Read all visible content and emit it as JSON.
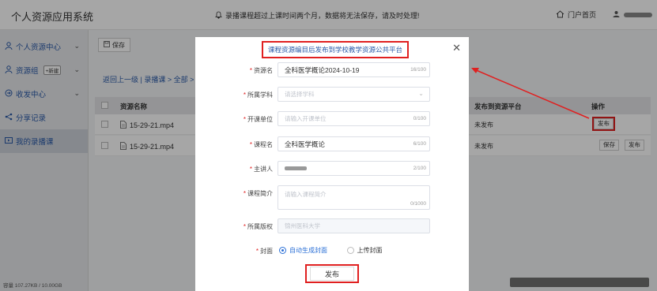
{
  "header": {
    "app_title": "个人资源应用系统",
    "notice": "录播课程超过上课时间两个月，数据将无法保存，请及时处理!",
    "portal_label": "门户首页"
  },
  "sidebar": {
    "items": [
      {
        "label": "个人资源中心",
        "icon": "person-icon",
        "has_chevron": true
      },
      {
        "label": "资源组",
        "icon": "group-icon",
        "badge": "+新建",
        "has_chevron": true
      },
      {
        "label": "收发中心",
        "icon": "transfer-icon",
        "has_chevron": true
      },
      {
        "label": "分享记录",
        "icon": "share-icon"
      },
      {
        "label": "我的录播课",
        "icon": "video-icon",
        "active": true
      }
    ],
    "storage": "容量 107.27KB / 10.00GB"
  },
  "main": {
    "save_label": "保存",
    "breadcrumb": "返回上一级 | 录播课 > 全部 >",
    "columns": {
      "name": "资源名称",
      "platform": "发布到资源平台",
      "ops": "操作"
    },
    "rows": [
      {
        "name": "15-29-21.mp4",
        "status": "未发布",
        "ops": [
          "发布"
        ]
      },
      {
        "name": "15-29-21.mp4",
        "status": "未发布",
        "ops": [
          "保存",
          "发布"
        ]
      }
    ]
  },
  "modal": {
    "title": "课程资源编目后发布到学校教学资源公共平台",
    "fields": {
      "resource_name": {
        "label": "资源名",
        "value": "全科医学概论2024-10-19",
        "count": "16/100"
      },
      "subject": {
        "label": "所属学科",
        "placeholder": "请选择学科"
      },
      "unit": {
        "label": "开课单位",
        "placeholder": "请输入开课单位",
        "count": "0/100"
      },
      "course_name": {
        "label": "课程名",
        "value": "全科医学概论",
        "count": "6/100"
      },
      "lecturer": {
        "label": "主讲人",
        "count": "2/100"
      },
      "intro": {
        "label": "课程简介",
        "placeholder": "请输入课程简介",
        "count": "0/1000"
      },
      "copyright": {
        "label": "所属版权",
        "value": "锦州医科大学"
      },
      "cover": {
        "label": "封面",
        "option_auto": "自动生成封面",
        "option_upload": "上传封面"
      }
    },
    "publish_label": "发布"
  },
  "colors": {
    "accent": "#2a6fd6",
    "link": "#2a5aa8",
    "highlight": "#e02020"
  }
}
